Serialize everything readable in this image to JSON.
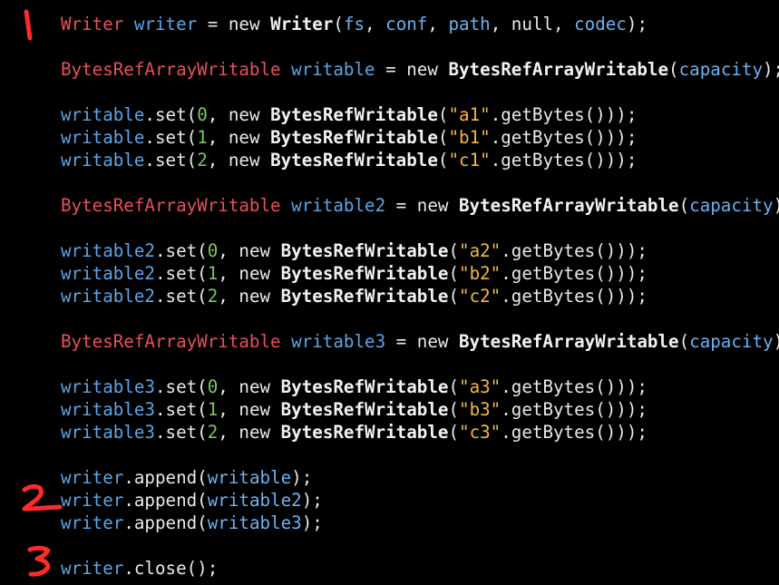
{
  "annotations": [
    "1",
    "2",
    "3"
  ],
  "colors": {
    "background": "#000000",
    "type": "#e8505b",
    "variable": "#5ba6e8",
    "number": "#7ec46a",
    "string": "#f5b841",
    "annotation": "#ff2a2a"
  },
  "code_lines": [
    [
      {
        "c": "t-type",
        "t": "Writer"
      },
      {
        "c": "t-plain",
        "t": " "
      },
      {
        "c": "t-var",
        "t": "writer"
      },
      {
        "c": "t-plain",
        "t": " = new "
      },
      {
        "c": "t-class",
        "t": "Writer"
      },
      {
        "c": "t-plain",
        "t": "("
      },
      {
        "c": "t-field",
        "t": "fs"
      },
      {
        "c": "t-plain",
        "t": ", "
      },
      {
        "c": "t-field",
        "t": "conf"
      },
      {
        "c": "t-plain",
        "t": ", "
      },
      {
        "c": "t-field",
        "t": "path"
      },
      {
        "c": "t-plain",
        "t": ", null, "
      },
      {
        "c": "t-field",
        "t": "codec"
      },
      {
        "c": "t-plain",
        "t": ");"
      }
    ],
    [],
    [
      {
        "c": "t-type",
        "t": "BytesRefArrayWritable"
      },
      {
        "c": "t-plain",
        "t": " "
      },
      {
        "c": "t-var",
        "t": "writable"
      },
      {
        "c": "t-plain",
        "t": " = new "
      },
      {
        "c": "t-class",
        "t": "BytesRefArrayWritable"
      },
      {
        "c": "t-plain",
        "t": "("
      },
      {
        "c": "t-field",
        "t": "capacity"
      },
      {
        "c": "t-plain",
        "t": ");"
      }
    ],
    [],
    [
      {
        "c": "t-var",
        "t": "writable"
      },
      {
        "c": "t-plain",
        "t": ".set("
      },
      {
        "c": "t-num",
        "t": "0"
      },
      {
        "c": "t-plain",
        "t": ", new "
      },
      {
        "c": "t-class",
        "t": "BytesRefWritable"
      },
      {
        "c": "t-plain",
        "t": "("
      },
      {
        "c": "t-str",
        "t": "\"a1\""
      },
      {
        "c": "t-plain",
        "t": ".getBytes()));"
      }
    ],
    [
      {
        "c": "t-var",
        "t": "writable"
      },
      {
        "c": "t-plain",
        "t": ".set("
      },
      {
        "c": "t-num",
        "t": "1"
      },
      {
        "c": "t-plain",
        "t": ", new "
      },
      {
        "c": "t-class",
        "t": "BytesRefWritable"
      },
      {
        "c": "t-plain",
        "t": "("
      },
      {
        "c": "t-str",
        "t": "\"b1\""
      },
      {
        "c": "t-plain",
        "t": ".getBytes()));"
      }
    ],
    [
      {
        "c": "t-var",
        "t": "writable"
      },
      {
        "c": "t-plain",
        "t": ".set("
      },
      {
        "c": "t-num",
        "t": "2"
      },
      {
        "c": "t-plain",
        "t": ", new "
      },
      {
        "c": "t-class",
        "t": "BytesRefWritable"
      },
      {
        "c": "t-plain",
        "t": "("
      },
      {
        "c": "t-str",
        "t": "\"c1\""
      },
      {
        "c": "t-plain",
        "t": ".getBytes()));"
      }
    ],
    [],
    [
      {
        "c": "t-type",
        "t": "BytesRefArrayWritable"
      },
      {
        "c": "t-plain",
        "t": " "
      },
      {
        "c": "t-var",
        "t": "writable2"
      },
      {
        "c": "t-plain",
        "t": " = new "
      },
      {
        "c": "t-class",
        "t": "BytesRefArrayWritable"
      },
      {
        "c": "t-plain",
        "t": "("
      },
      {
        "c": "t-field",
        "t": "capacity"
      },
      {
        "c": "t-plain",
        "t": ");"
      }
    ],
    [],
    [
      {
        "c": "t-var",
        "t": "writable2"
      },
      {
        "c": "t-plain",
        "t": ".set("
      },
      {
        "c": "t-num",
        "t": "0"
      },
      {
        "c": "t-plain",
        "t": ", new "
      },
      {
        "c": "t-class",
        "t": "BytesRefWritable"
      },
      {
        "c": "t-plain",
        "t": "("
      },
      {
        "c": "t-str",
        "t": "\"a2\""
      },
      {
        "c": "t-plain",
        "t": ".getBytes()));"
      }
    ],
    [
      {
        "c": "t-var",
        "t": "writable2"
      },
      {
        "c": "t-plain",
        "t": ".set("
      },
      {
        "c": "t-num",
        "t": "1"
      },
      {
        "c": "t-plain",
        "t": ", new "
      },
      {
        "c": "t-class",
        "t": "BytesRefWritable"
      },
      {
        "c": "t-plain",
        "t": "("
      },
      {
        "c": "t-str",
        "t": "\"b2\""
      },
      {
        "c": "t-plain",
        "t": ".getBytes()));"
      }
    ],
    [
      {
        "c": "t-var",
        "t": "writable2"
      },
      {
        "c": "t-plain",
        "t": ".set("
      },
      {
        "c": "t-num",
        "t": "2"
      },
      {
        "c": "t-plain",
        "t": ", new "
      },
      {
        "c": "t-class",
        "t": "BytesRefWritable"
      },
      {
        "c": "t-plain",
        "t": "("
      },
      {
        "c": "t-str",
        "t": "\"c2\""
      },
      {
        "c": "t-plain",
        "t": ".getBytes()));"
      }
    ],
    [],
    [
      {
        "c": "t-type",
        "t": "BytesRefArrayWritable"
      },
      {
        "c": "t-plain",
        "t": " "
      },
      {
        "c": "t-var",
        "t": "writable3"
      },
      {
        "c": "t-plain",
        "t": " = new "
      },
      {
        "c": "t-class",
        "t": "BytesRefArrayWritable"
      },
      {
        "c": "t-plain",
        "t": "("
      },
      {
        "c": "t-field",
        "t": "capacity"
      },
      {
        "c": "t-plain",
        "t": ");"
      }
    ],
    [],
    [
      {
        "c": "t-var",
        "t": "writable3"
      },
      {
        "c": "t-plain",
        "t": ".set("
      },
      {
        "c": "t-num",
        "t": "0"
      },
      {
        "c": "t-plain",
        "t": ", new "
      },
      {
        "c": "t-class",
        "t": "BytesRefWritable"
      },
      {
        "c": "t-plain",
        "t": "("
      },
      {
        "c": "t-str",
        "t": "\"a3\""
      },
      {
        "c": "t-plain",
        "t": ".getBytes()));"
      }
    ],
    [
      {
        "c": "t-var",
        "t": "writable3"
      },
      {
        "c": "t-plain",
        "t": ".set("
      },
      {
        "c": "t-num",
        "t": "1"
      },
      {
        "c": "t-plain",
        "t": ", new "
      },
      {
        "c": "t-class",
        "t": "BytesRefWritable"
      },
      {
        "c": "t-plain",
        "t": "("
      },
      {
        "c": "t-str",
        "t": "\"b3\""
      },
      {
        "c": "t-plain",
        "t": ".getBytes()));"
      }
    ],
    [
      {
        "c": "t-var",
        "t": "writable3"
      },
      {
        "c": "t-plain",
        "t": ".set("
      },
      {
        "c": "t-num",
        "t": "2"
      },
      {
        "c": "t-plain",
        "t": ", new "
      },
      {
        "c": "t-class",
        "t": "BytesRefWritable"
      },
      {
        "c": "t-plain",
        "t": "("
      },
      {
        "c": "t-str",
        "t": "\"c3\""
      },
      {
        "c": "t-plain",
        "t": ".getBytes()));"
      }
    ],
    [],
    [
      {
        "c": "t-var",
        "t": "writer"
      },
      {
        "c": "t-plain",
        "t": ".append("
      },
      {
        "c": "t-field",
        "t": "writable"
      },
      {
        "c": "t-plain",
        "t": ");"
      }
    ],
    [
      {
        "c": "t-var",
        "t": "writer"
      },
      {
        "c": "t-plain",
        "t": ".append("
      },
      {
        "c": "t-field",
        "t": "writable2"
      },
      {
        "c": "t-plain",
        "t": ");"
      }
    ],
    [
      {
        "c": "t-var",
        "t": "writer"
      },
      {
        "c": "t-plain",
        "t": ".append("
      },
      {
        "c": "t-field",
        "t": "writable3"
      },
      {
        "c": "t-plain",
        "t": ");"
      }
    ],
    [],
    [
      {
        "c": "t-var",
        "t": "writer"
      },
      {
        "c": "t-plain",
        "t": ".close();"
      }
    ]
  ]
}
